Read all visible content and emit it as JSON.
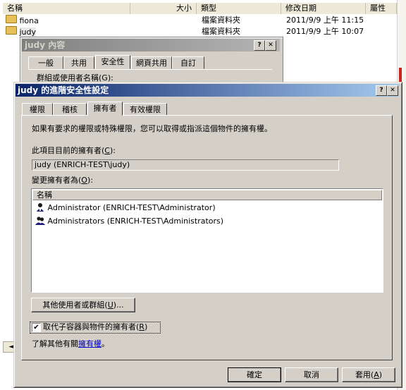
{
  "explorer": {
    "columns": [
      "名稱",
      "大小",
      "類型",
      "修改日期",
      "屬性"
    ],
    "rows": [
      {
        "name": "fiona",
        "type": "檔案資料夾",
        "date": "2011/9/9 上午 11:15"
      },
      {
        "name": "judy",
        "type": "檔案資料夾",
        "date": "2011/9/9 上午 10:07"
      }
    ],
    "scroll_arrow": "◄"
  },
  "props_window": {
    "title": "judy 內容",
    "help": "?",
    "close": "✕",
    "tabs": [
      "一般",
      "共用",
      "安全性",
      "網頁共用",
      "自訂"
    ],
    "partial_text": "群組或使用者名稱(G):"
  },
  "dialog": {
    "title": "judy 的進階安全性設定",
    "help": "?",
    "close": "✕",
    "tabs": [
      "權限",
      "稽核",
      "擁有者",
      "有效權限"
    ],
    "active_tab": "擁有者",
    "description": "如果有要求的權限或特殊權限，您可以取得或指派這個物件的擁有權。",
    "current_owner_label_pre": "此項目目前的擁有者(",
    "current_owner_label_key": "C",
    "current_owner_label_post": "):",
    "current_owner_value": "judy (ENRICH-TEST\\judy)",
    "change_owner_label_pre": "變更擁有者為(",
    "change_owner_label_key": "O",
    "change_owner_label_post": "):",
    "list_header": "名稱",
    "owners": [
      {
        "name": "Administrator (ENRICH-TEST\\Administrator)",
        "icon": "user-icon"
      },
      {
        "name": "Administrators (ENRICH-TEST\\Administrators)",
        "icon": "group-icon"
      }
    ],
    "other_users_button_pre": "其他使用者或群組(",
    "other_users_button_key": "U",
    "other_users_button_post": ")...",
    "replace_checkbox_pre": "取代子容器與物件的擁有者(",
    "replace_checkbox_key": "R",
    "replace_checkbox_post": ")",
    "replace_checked": true,
    "checkmark": "✔",
    "learn_more_pre": "了解其他有關",
    "learn_more_link": "擁有權",
    "learn_more_post": "。",
    "ok_label": "確定",
    "cancel_label": "取消",
    "apply_pre": "套用(",
    "apply_key": "A",
    "apply_post": ")"
  }
}
